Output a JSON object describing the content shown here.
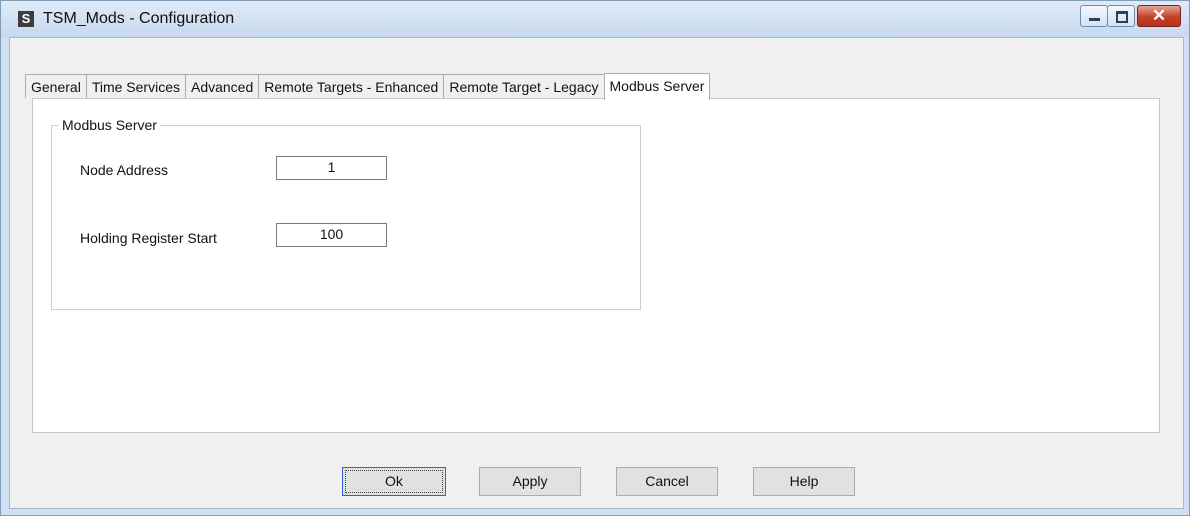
{
  "window": {
    "title": "TSM_Mods - Configuration",
    "app_icon": "S"
  },
  "title_buttons": {
    "minimize": "minimize",
    "maximize": "maximize",
    "close": "✕"
  },
  "tabs": [
    {
      "label": "General"
    },
    {
      "label": "Time Services"
    },
    {
      "label": "Advanced"
    },
    {
      "label": "Remote Targets - Enhanced"
    },
    {
      "label": "Remote Target - Legacy"
    },
    {
      "label": "Modbus Server",
      "active": true
    }
  ],
  "modbus": {
    "group_title": "Modbus Server",
    "node_address_label": "Node Address",
    "node_address_value": "1",
    "holding_register_label": "Holding Register Start",
    "holding_register_value": "100"
  },
  "buttons": {
    "ok": "Ok",
    "apply": "Apply",
    "cancel": "Cancel",
    "help": "Help"
  },
  "colors": {
    "frame": "#cfe0f3",
    "dialog_bg": "#f0f0f0",
    "close_button": "#c4412a",
    "default_button_border": "#2c62d6"
  }
}
